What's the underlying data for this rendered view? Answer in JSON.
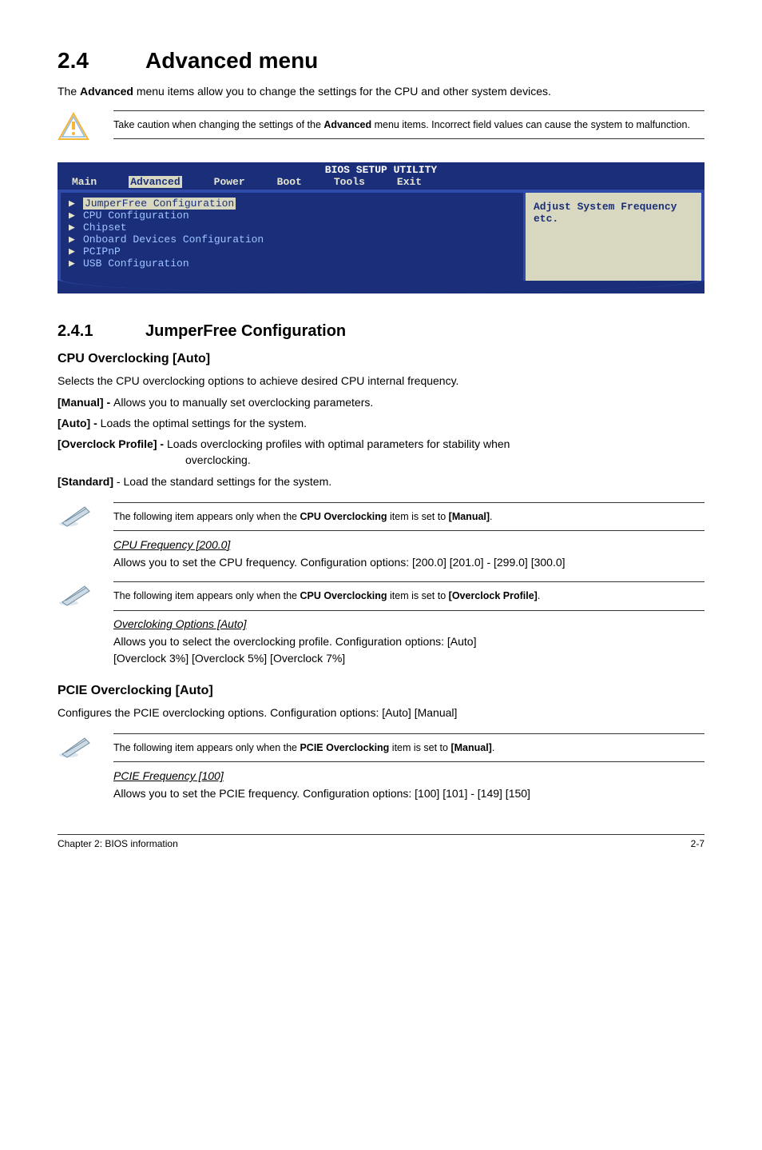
{
  "section": {
    "number": "2.4",
    "title": "Advanced menu",
    "intro_1": "The ",
    "intro_bold": "Advanced",
    "intro_2": " menu items allow you to change the settings for the CPU and other system devices."
  },
  "warning": {
    "text_1": "Take caution when changing the settings of the ",
    "bold": "Advanced",
    "text_2": " menu items. Incorrect field values can cause the system to malfunction."
  },
  "bios": {
    "title": "BIOS SETUP UTILITY",
    "menu": [
      "Main",
      "Advanced",
      "Power",
      "Boot",
      "Tools",
      "Exit"
    ],
    "menu_selected_index": 1,
    "items": [
      {
        "label": "JumperFree Configuration",
        "highlight": true
      },
      {
        "label": "CPU Configuration"
      },
      {
        "label": "Chipset"
      },
      {
        "label": "Onboard Devices Configuration"
      },
      {
        "label": "PCIPnP"
      },
      {
        "label": "USB Configuration"
      }
    ],
    "help": "Adjust System Frequency etc."
  },
  "subsection": {
    "number": "2.4.1",
    "title": "JumperFree Configuration"
  },
  "cpu_oc": {
    "heading": "CPU Overclocking [Auto]",
    "desc": "Selects the CPU overclocking options to achieve desired CPU internal frequency.",
    "manual_label": "[Manual] - ",
    "manual_text": "Allows you to manually set overclocking parameters.",
    "auto_label": "[Auto] - ",
    "auto_text": "Loads the optimal settings for the system.",
    "over_label": "[Overclock Profile] - ",
    "over_text_1": "Loads overclocking profiles with optimal parameters for stability when ",
    "over_text_cont": "overclocking.",
    "std_label": "[Standard]",
    "std_text": " - Load the standard settings for the system."
  },
  "note1": {
    "t1": "The following item appears only when the ",
    "b1": "CPU Overclocking",
    "t2": " item is set to ",
    "b2": "[Manual]",
    "t3": "."
  },
  "cpu_freq": {
    "title": "CPU Frequency [200.0]",
    "text": "Allows you to set the CPU frequency. Configuration options: [200.0] [201.0] - [299.0] [300.0]"
  },
  "note2": {
    "t1": "The following item appears only when the ",
    "b1": "CPU Overclocking",
    "t2": " item is set to ",
    "b2": "[Overclock Profile]",
    "t3": "."
  },
  "oc_opts": {
    "title": "Overcloking Options [Auto]",
    "text1": "Allows you to select the overclocking profile. Configuration options: [Auto] ",
    "text2": "[Overclock 3%] [Overclock 5%] [Overclock 7%]"
  },
  "pcie_oc": {
    "heading": "PCIE Overclocking [Auto]",
    "desc": "Configures the PCIE overclocking options. Configuration options: [Auto] [Manual]"
  },
  "note3": {
    "t1": "The following item appears only when the ",
    "b1": "PCIE Overclocking",
    "t2": " item is set to ",
    "b2": "[Manual]",
    "t3": "."
  },
  "pcie_freq": {
    "title": "PCIE Frequency [100]",
    "text": "Allows you to set the PCIE frequency. Configuration options: [100] [101] - [149] [150]"
  },
  "footer": {
    "left": "Chapter 2: BIOS information",
    "right": "2-7"
  }
}
